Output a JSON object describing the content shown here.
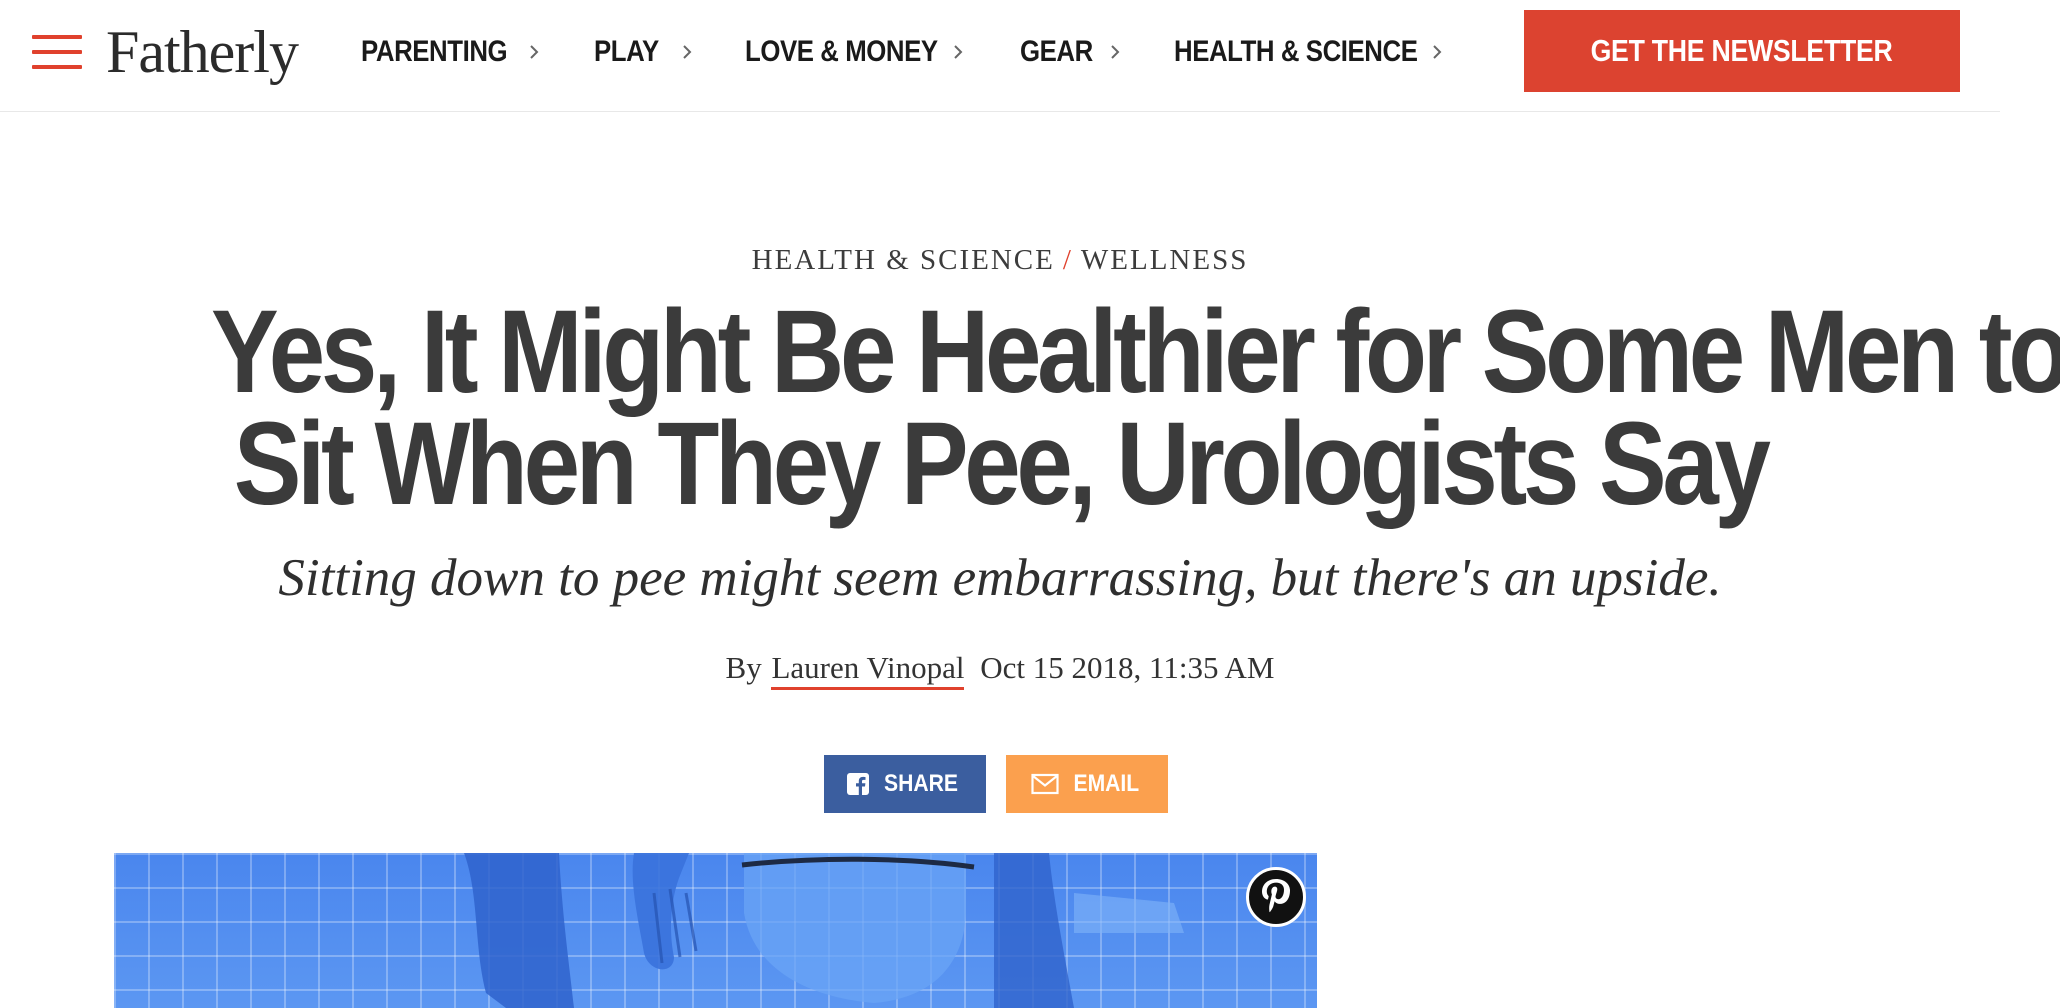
{
  "brand": {
    "name": "Fatherly",
    "accent_color": "#e0412d"
  },
  "header": {
    "menu_icon": "hamburger-menu-icon",
    "nav": [
      {
        "label": "PARENTING"
      },
      {
        "label": "PLAY"
      },
      {
        "label": "LOVE & MONEY"
      },
      {
        "label": "GEAR"
      },
      {
        "label": "HEALTH & SCIENCE"
      }
    ],
    "nav_chevron_icon": "chevron-right-icon",
    "newsletter_label": "GET THE NEWSLETTER",
    "newsletter_color": "#dc4330"
  },
  "article": {
    "breadcrumb": {
      "section": "HEALTH & SCIENCE",
      "separator": "/",
      "subsection": "WELLNESS"
    },
    "headline": {
      "line1": "Yes, It Might Be Healthier for Some Men to",
      "line2": "Sit When They Pee, Urologists Say"
    },
    "dek": "Sitting down to pee might seem embarrassing, but there's an upside.",
    "byline": {
      "prefix": "By",
      "author": "Lauren Vinopal",
      "date": "Oct 15 2018, 11:35 AM"
    },
    "share": {
      "facebook_label": "SHARE",
      "facebook_icon": "facebook-icon",
      "facebook_color": "#3b5e9f",
      "email_label": "EMAIL",
      "email_icon": "envelope-icon",
      "email_color": "#fba04e"
    },
    "hero": {
      "pin_icon": "pinterest-icon"
    }
  }
}
